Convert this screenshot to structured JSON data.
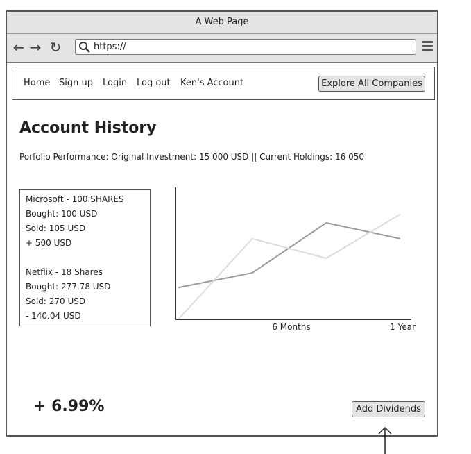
{
  "browser": {
    "window_title": "A Web Page",
    "url": "https://"
  },
  "nav": {
    "links": [
      "Home",
      "Sign up",
      "Login",
      "Log out",
      "Ken's Account"
    ],
    "explore_button": "Explore All Companies"
  },
  "page": {
    "title": "Account History",
    "performance_text": "Porfolio Performance: Original Investment: 15 000 USD  || Current Holdings: 16 050",
    "holdings": {
      "microsoft": [
        "Microsoft  - 100 SHARES",
        "Bought: 100 USD",
        "Sold: 105 USD",
        "+ 500 USD"
      ],
      "netflix": [
        "Netflix - 18 Shares",
        "Bought: 277.78 USD",
        "Sold: 270 USD",
        "- 140.04 USD"
      ]
    },
    "percent_change": "+ 6.99%",
    "dividends_button": "Add Dividends"
  },
  "chart_data": {
    "type": "line",
    "x_tick_labels": [
      "6 Months",
      "1 Year"
    ],
    "x": [
      0,
      0.5,
      1.0,
      1.5
    ],
    "series": [
      {
        "values": [
          0.26,
          0.38,
          0.79,
          0.66
        ],
        "color": "#9a9a9a"
      },
      {
        "values": [
          0.0,
          0.66,
          0.5,
          0.86
        ],
        "color": "#dcdcdc"
      }
    ],
    "ylim": [
      0,
      1
    ],
    "grid": false
  }
}
